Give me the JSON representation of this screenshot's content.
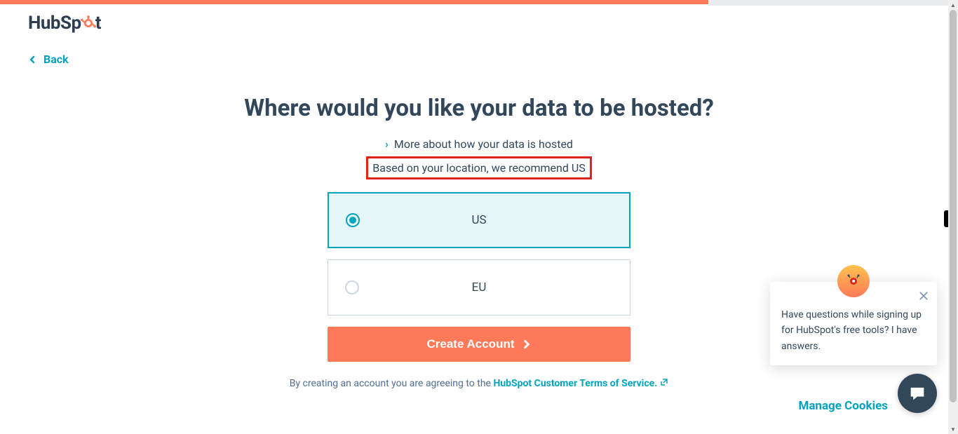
{
  "brand": "HubSpot",
  "nav": {
    "back_label": "Back"
  },
  "page": {
    "title": "Where would you like your data to be hosted?",
    "more_info": "More about how your data is hosted",
    "recommendation": "Based on your location, we recommend US"
  },
  "options": [
    {
      "label": "US",
      "selected": true
    },
    {
      "label": "EU",
      "selected": false
    }
  ],
  "cta": {
    "label": "Create Account"
  },
  "terms": {
    "prefix": "By creating an account you are agreeing to the ",
    "link1": "HubSpot Customer Terms of Service."
  },
  "cookies": {
    "manage_label": "Manage Cookies"
  },
  "chat": {
    "message": "Have questions while signing up for HubSpot's free tools? I have answers."
  }
}
